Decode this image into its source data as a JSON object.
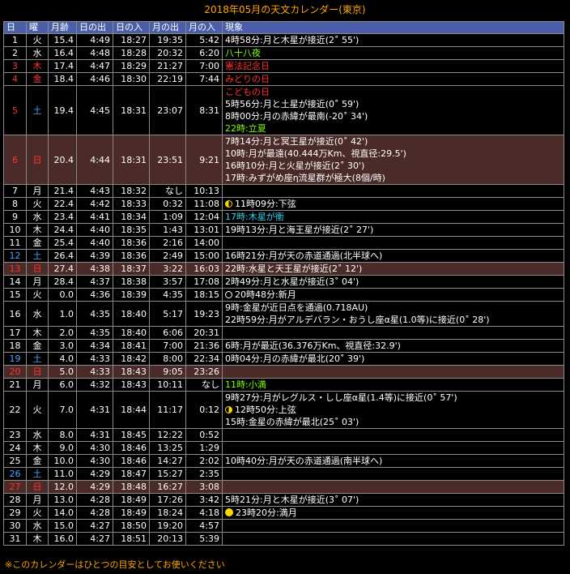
{
  "title": "2018年05月の天文カレンダー(東京)",
  "headers": [
    "日",
    "曜",
    "月齢",
    "日の出",
    "日の入",
    "月の出",
    "月の入",
    "現象"
  ],
  "footer": "※このカレンダーはひとつの目安としてお使いください",
  "colors": {
    "header_bg": "#4a5fa8",
    "holiday_row_bg": "#4a2b28",
    "title": "#ffa500",
    "saturday": "#4fa3ff",
    "sunday": "#ff3333"
  },
  "rows": [
    {
      "day": "1",
      "dow": "火",
      "age": "15.4",
      "sunrise": "4:49",
      "sunset": "18:27",
      "moonrise": "19:35",
      "moonset": "5:42",
      "dtype": "",
      "hol": false,
      "events": [
        {
          "text": "4時58分:月と木星が接近(2˚ 55')",
          "color": "",
          "icon": ""
        }
      ]
    },
    {
      "day": "2",
      "dow": "水",
      "age": "16.4",
      "sunrise": "4:48",
      "sunset": "18:28",
      "moonrise": "20:32",
      "moonset": "6:20",
      "dtype": "",
      "hol": false,
      "events": [
        {
          "text": "八十八夜",
          "color": "green",
          "icon": ""
        }
      ]
    },
    {
      "day": "3",
      "dow": "木",
      "age": "17.4",
      "sunrise": "4:47",
      "sunset": "18:29",
      "moonrise": "21:27",
      "moonset": "7:00",
      "dtype": "sun",
      "hol": false,
      "events": [
        {
          "text": "憲法記念日",
          "color": "red",
          "icon": ""
        }
      ]
    },
    {
      "day": "4",
      "dow": "金",
      "age": "18.4",
      "sunrise": "4:46",
      "sunset": "18:30",
      "moonrise": "22:19",
      "moonset": "7:44",
      "dtype": "sun",
      "hol": false,
      "events": [
        {
          "text": "みどりの日",
          "color": "red",
          "icon": ""
        }
      ]
    },
    {
      "day": "5",
      "dow": "土",
      "age": "19.4",
      "sunrise": "4:45",
      "sunset": "18:31",
      "moonrise": "23:07",
      "moonset": "8:31",
      "dtype": "sun",
      "dowtype": "sat",
      "hol": false,
      "events": [
        {
          "text": "こどもの日",
          "color": "red",
          "icon": ""
        },
        {
          "text": "5時56分:月と土星が接近(0˚ 59')",
          "color": "",
          "icon": ""
        },
        {
          "text": "8時00分:月の赤緯が最南(-20˚ 34')",
          "color": "",
          "icon": ""
        },
        {
          "text": "22時:立夏",
          "color": "green",
          "icon": ""
        }
      ]
    },
    {
      "day": "6",
      "dow": "日",
      "age": "20.4",
      "sunrise": "4:44",
      "sunset": "18:31",
      "moonrise": "23:51",
      "moonset": "9:21",
      "dtype": "sun",
      "hol": true,
      "events": [
        {
          "text": "7時14分:月と冥王星が接近(0˚ 42')",
          "color": "",
          "icon": ""
        },
        {
          "text": "10時:月が最遠(40.444万Km、視直径:29.5')",
          "color": "",
          "icon": ""
        },
        {
          "text": "16時10分:月と火星が接近(2˚ 30')",
          "color": "",
          "icon": ""
        },
        {
          "text": "17時:みずがめ座η流星群が極大(8個/時)",
          "color": "",
          "icon": ""
        }
      ]
    },
    {
      "day": "7",
      "dow": "月",
      "age": "21.4",
      "sunrise": "4:43",
      "sunset": "18:32",
      "moonrise": "なし",
      "moonset": "10:13",
      "dtype": "",
      "hol": false,
      "events": []
    },
    {
      "day": "8",
      "dow": "火",
      "age": "22.4",
      "sunrise": "4:42",
      "sunset": "18:33",
      "moonrise": "0:32",
      "moonset": "11:08",
      "dtype": "",
      "hol": false,
      "events": [
        {
          "text": "11時09分:下弦",
          "color": "",
          "icon": "last"
        }
      ]
    },
    {
      "day": "9",
      "dow": "水",
      "age": "23.4",
      "sunrise": "4:41",
      "sunset": "18:34",
      "moonrise": "1:09",
      "moonset": "12:04",
      "dtype": "",
      "hol": false,
      "events": [
        {
          "text": "17時:木星が衝",
          "color": "cyan",
          "icon": ""
        }
      ]
    },
    {
      "day": "10",
      "dow": "木",
      "age": "24.4",
      "sunrise": "4:40",
      "sunset": "18:35",
      "moonrise": "1:43",
      "moonset": "13:01",
      "dtype": "",
      "hol": false,
      "events": [
        {
          "text": "19時13分:月と海王星が接近(2˚ 27')",
          "color": "",
          "icon": ""
        }
      ]
    },
    {
      "day": "11",
      "dow": "金",
      "age": "25.4",
      "sunrise": "4:40",
      "sunset": "18:36",
      "moonrise": "2:16",
      "moonset": "14:00",
      "dtype": "",
      "hol": false,
      "events": []
    },
    {
      "day": "12",
      "dow": "土",
      "age": "26.4",
      "sunrise": "4:39",
      "sunset": "18:36",
      "moonrise": "2:49",
      "moonset": "15:00",
      "dtype": "sat",
      "hol": false,
      "events": [
        {
          "text": "16時21分:月が天の赤道通過(北半球へ)",
          "color": "",
          "icon": ""
        }
      ]
    },
    {
      "day": "13",
      "dow": "日",
      "age": "27.4",
      "sunrise": "4:38",
      "sunset": "18:37",
      "moonrise": "3:22",
      "moonset": "16:03",
      "dtype": "sun",
      "hol": true,
      "events": [
        {
          "text": "22時:水星と天王星が接近(2˚ 12')",
          "color": "",
          "icon": ""
        }
      ]
    },
    {
      "day": "14",
      "dow": "月",
      "age": "28.4",
      "sunrise": "4:37",
      "sunset": "18:38",
      "moonrise": "3:57",
      "moonset": "17:08",
      "dtype": "",
      "hol": false,
      "events": [
        {
          "text": "2時49分:月と水星が接近(3˚ 04')",
          "color": "",
          "icon": ""
        }
      ]
    },
    {
      "day": "15",
      "dow": "火",
      "age": "0.0",
      "sunrise": "4:36",
      "sunset": "18:39",
      "moonrise": "4:35",
      "moonset": "18:15",
      "dtype": "",
      "hol": false,
      "events": [
        {
          "text": "20時48分:新月",
          "color": "",
          "icon": "new"
        }
      ]
    },
    {
      "day": "16",
      "dow": "水",
      "age": "1.0",
      "sunrise": "4:35",
      "sunset": "18:40",
      "moonrise": "5:17",
      "moonset": "19:23",
      "dtype": "",
      "hol": false,
      "events": [
        {
          "text": "9時:金星が近日点を通過(0.718AU)",
          "color": "",
          "icon": ""
        },
        {
          "text": "22時59分:月がアルデバラン・おうし座α星(1.0等)に接近(0˚ 28')",
          "color": "",
          "icon": ""
        }
      ]
    },
    {
      "day": "17",
      "dow": "木",
      "age": "2.0",
      "sunrise": "4:35",
      "sunset": "18:40",
      "moonrise": "6:06",
      "moonset": "20:31",
      "dtype": "",
      "hol": false,
      "events": []
    },
    {
      "day": "18",
      "dow": "金",
      "age": "3.0",
      "sunrise": "4:34",
      "sunset": "18:41",
      "moonrise": "7:00",
      "moonset": "21:36",
      "dtype": "",
      "hol": false,
      "events": [
        {
          "text": "6時:月が最近(36.376万Km、視直径:32.9')",
          "color": "",
          "icon": ""
        }
      ]
    },
    {
      "day": "19",
      "dow": "土",
      "age": "4.0",
      "sunrise": "4:33",
      "sunset": "18:42",
      "moonrise": "8:00",
      "moonset": "22:34",
      "dtype": "sat",
      "hol": false,
      "events": [
        {
          "text": "0時04分:月の赤緯が最北(20˚ 39')",
          "color": "",
          "icon": ""
        }
      ]
    },
    {
      "day": "20",
      "dow": "日",
      "age": "5.0",
      "sunrise": "4:33",
      "sunset": "18:43",
      "moonrise": "9:05",
      "moonset": "23:26",
      "dtype": "sun",
      "hol": true,
      "events": []
    },
    {
      "day": "21",
      "dow": "月",
      "age": "6.0",
      "sunrise": "4:32",
      "sunset": "18:43",
      "moonrise": "10:11",
      "moonset": "なし",
      "dtype": "",
      "hol": false,
      "events": [
        {
          "text": "11時:小満",
          "color": "green",
          "icon": ""
        }
      ]
    },
    {
      "day": "22",
      "dow": "火",
      "age": "7.0",
      "sunrise": "4:31",
      "sunset": "18:44",
      "moonrise": "11:17",
      "moonset": "0:12",
      "dtype": "",
      "hol": false,
      "events": [
        {
          "text": "9時27分:月がレグルス・しし座α星(1.4等)に接近(0˚ 57')",
          "color": "",
          "icon": ""
        },
        {
          "text": "12時50分:上弦",
          "color": "",
          "icon": "first"
        },
        {
          "text": "15時:金星の赤緯が最北(25˚ 03')",
          "color": "",
          "icon": ""
        }
      ]
    },
    {
      "day": "23",
      "dow": "水",
      "age": "8.0",
      "sunrise": "4:31",
      "sunset": "18:45",
      "moonrise": "12:22",
      "moonset": "0:52",
      "dtype": "",
      "hol": false,
      "events": []
    },
    {
      "day": "24",
      "dow": "木",
      "age": "9.0",
      "sunrise": "4:30",
      "sunset": "18:46",
      "moonrise": "13:25",
      "moonset": "1:29",
      "dtype": "",
      "hol": false,
      "events": []
    },
    {
      "day": "25",
      "dow": "金",
      "age": "10.0",
      "sunrise": "4:30",
      "sunset": "18:46",
      "moonrise": "14:27",
      "moonset": "2:02",
      "dtype": "",
      "hol": false,
      "events": [
        {
          "text": "10時40分:月が天の赤道通過(南半球へ)",
          "color": "",
          "icon": ""
        }
      ]
    },
    {
      "day": "26",
      "dow": "土",
      "age": "11.0",
      "sunrise": "4:29",
      "sunset": "18:47",
      "moonrise": "15:27",
      "moonset": "2:35",
      "dtype": "sat",
      "hol": false,
      "events": []
    },
    {
      "day": "27",
      "dow": "日",
      "age": "12.0",
      "sunrise": "4:29",
      "sunset": "18:48",
      "moonrise": "16:27",
      "moonset": "3:08",
      "dtype": "sun",
      "hol": true,
      "events": []
    },
    {
      "day": "28",
      "dow": "月",
      "age": "13.0",
      "sunrise": "4:28",
      "sunset": "18:49",
      "moonrise": "17:26",
      "moonset": "3:42",
      "dtype": "",
      "hol": false,
      "events": [
        {
          "text": "5時21分:月と木星が接近(3˚ 07')",
          "color": "",
          "icon": ""
        }
      ]
    },
    {
      "day": "29",
      "dow": "火",
      "age": "14.0",
      "sunrise": "4:28",
      "sunset": "18:49",
      "moonrise": "18:24",
      "moonset": "4:18",
      "dtype": "",
      "hol": false,
      "events": [
        {
          "text": "23時20分:満月",
          "color": "",
          "icon": "full"
        }
      ]
    },
    {
      "day": "30",
      "dow": "水",
      "age": "15.0",
      "sunrise": "4:27",
      "sunset": "18:50",
      "moonrise": "19:20",
      "moonset": "4:57",
      "dtype": "",
      "hol": false,
      "events": []
    },
    {
      "day": "31",
      "dow": "木",
      "age": "16.0",
      "sunrise": "4:27",
      "sunset": "18:51",
      "moonrise": "20:13",
      "moonset": "5:39",
      "dtype": "",
      "hol": false,
      "events": []
    }
  ]
}
